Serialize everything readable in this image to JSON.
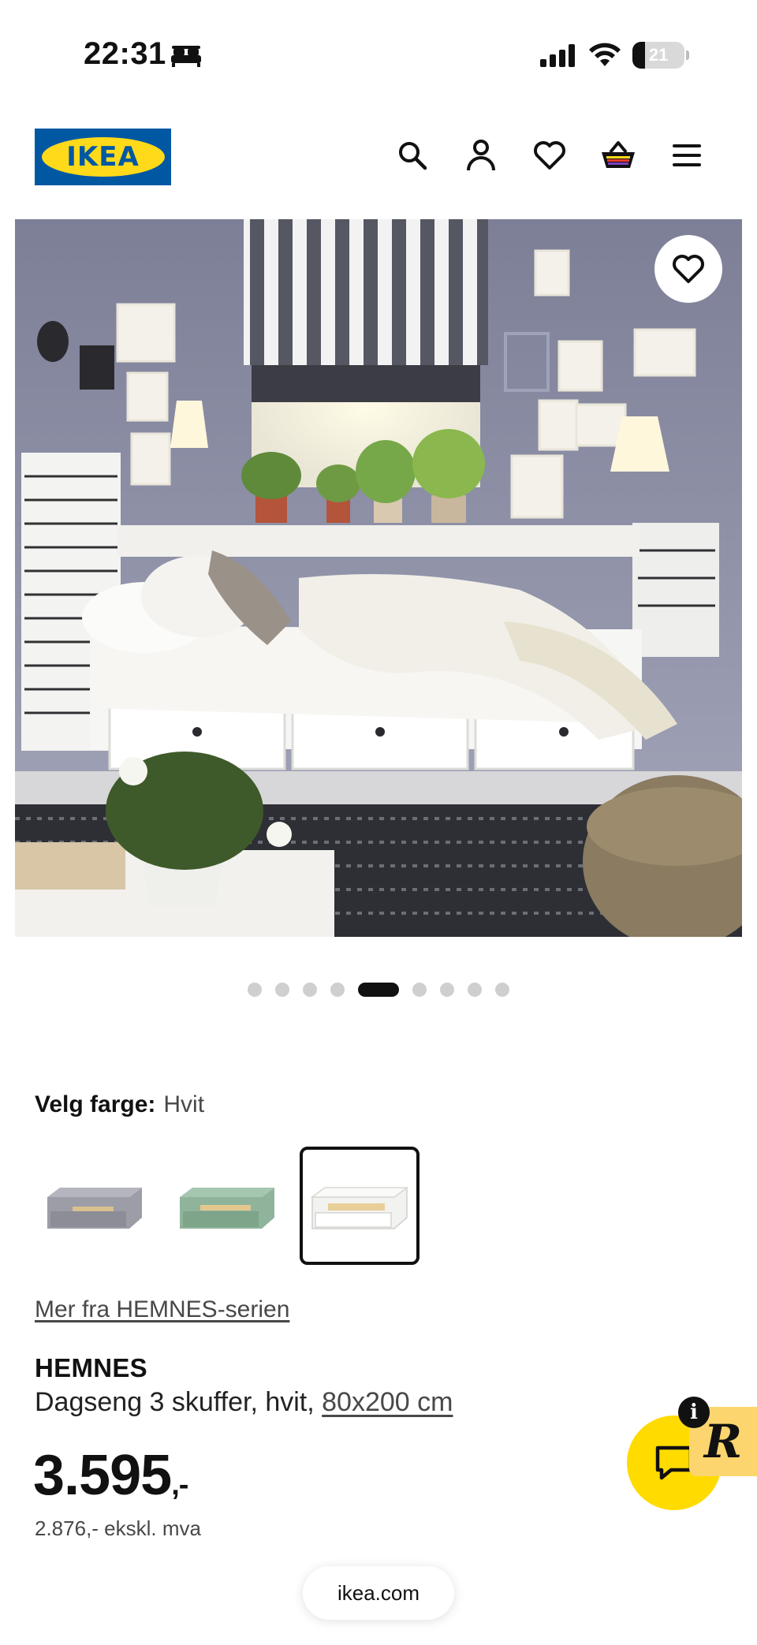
{
  "status_bar": {
    "time": "22:31",
    "battery": "21",
    "icons": [
      "bed-icon",
      "signal-icon",
      "wifi-icon",
      "battery-icon"
    ]
  },
  "header": {
    "logo_text": "IKEA",
    "icons": [
      "search-icon",
      "account-icon",
      "heart-icon",
      "shopping-basket-icon",
      "menu-icon"
    ]
  },
  "gallery": {
    "image_description_name": "room-scene-image",
    "dot_count": 9,
    "active_index": 4
  },
  "color": {
    "label": "Velg farge:",
    "value": "Hvit",
    "swatches": [
      "grey",
      "green",
      "white"
    ],
    "selected": 2
  },
  "series_link": "Mer fra HEMNES-serien",
  "product": {
    "name": "HEMNES",
    "description": "Dagseng 3 skuffer, hvit, ",
    "size": "80x200 cm",
    "price": "3.595",
    "price_suffix": ",-",
    "price_ex_vat": "2.876,- ekskl. mva"
  },
  "chat": {
    "info": "i",
    "badge_letter": "R"
  },
  "url": "ikea.com",
  "colors": {
    "accent_blue": "#0058a3",
    "accent_yellow": "#ffda1a",
    "chat_yellow": "#ffdb00"
  }
}
